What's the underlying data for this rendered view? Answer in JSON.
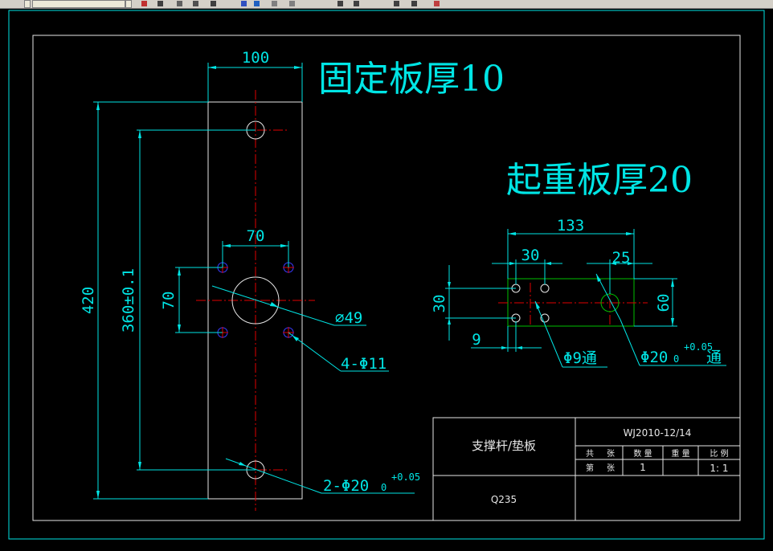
{
  "toolbar": {
    "icons": [
      "dropdown-arrow-icon",
      "tool-icon",
      "undo-icon",
      "redo-icon",
      "pan-icon",
      "zoom-icon",
      "layer-icon",
      "properties-icon",
      "match-icon",
      "tool-icon",
      "tool-icon",
      "tool-icon",
      "tool-icon"
    ]
  },
  "notes": {
    "fixed_plate": "固定板厚10",
    "lifting_plate": "起重板厚20"
  },
  "fixed_plate_dims": {
    "width": "100",
    "height": "420",
    "hole_spacing": "360±0.1",
    "bolt_spacing_h": "70",
    "bolt_spacing_v": "70",
    "center_hole": "⌀49",
    "bolt_holes": "4-Φ11",
    "end_holes_prefix": "2-Φ20",
    "end_holes_tol_upper": "+0.05",
    "end_holes_tol_lower": "0"
  },
  "lifting_plate_dims": {
    "length": "133",
    "hole_pitch": "30",
    "end_offset": "25",
    "hole_spacing_v": "30",
    "height": "60",
    "edge_offset": "9",
    "small_holes": "Φ9通",
    "big_hole_prefix": "Φ20",
    "big_hole_tol_upper": "+0.05",
    "big_hole_tol_lower": "0",
    "big_hole_suffix": "通"
  },
  "title_block": {
    "part_name": "支撑杆/垫板",
    "material": "Q235",
    "drawing_no": "WJ2010-12/14",
    "col_total": "共",
    "col_sheet": "张",
    "col_qty": "数 量",
    "col_weight": "重 量",
    "col_scale": "比 例",
    "row_no": "第",
    "row_sheet": "张",
    "qty_value": "1",
    "scale_value": "1: 1"
  }
}
